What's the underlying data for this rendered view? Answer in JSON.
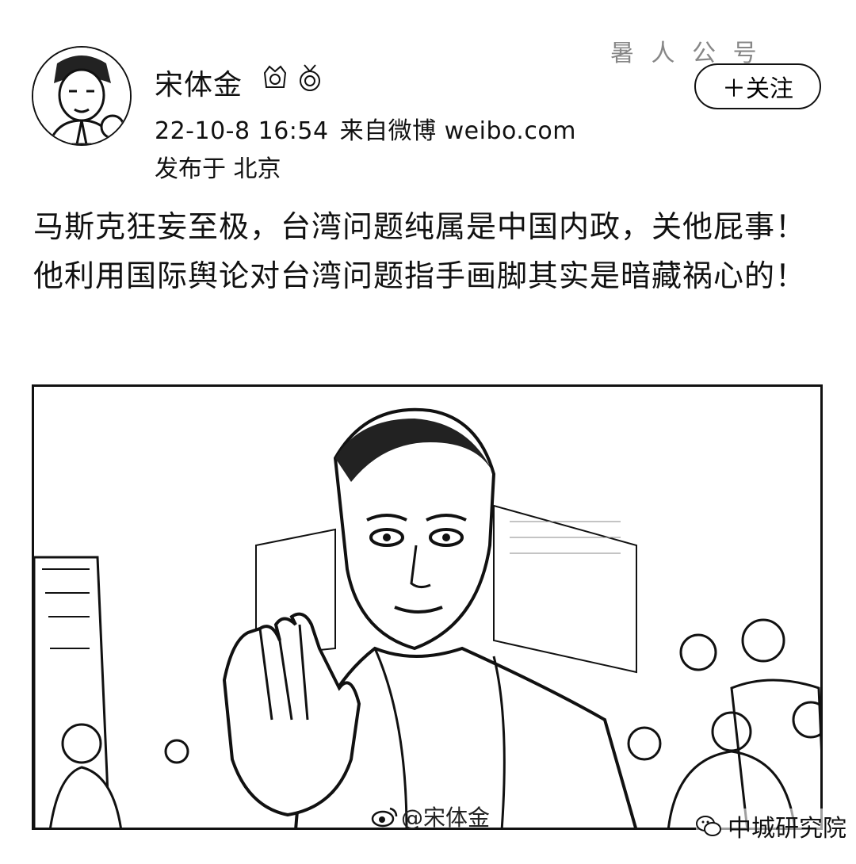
{
  "post": {
    "author": {
      "name": "宋体金",
      "badges": [
        "vip-badge-icon",
        "medal-badge-icon"
      ]
    },
    "meta": {
      "timestamp": "22-10-8 16:54",
      "source": "来自微博 weibo.com",
      "location": "发布于 北京"
    },
    "faded_overlay": "暑 人 公 号",
    "follow_label": "＋关注",
    "text": "马斯克狂妄至极，台湾问题纯属是中国内政，关他屁事！他利用国际舆论对台湾问题指手画脚其实是暗藏祸心的！",
    "image": {
      "watermark": "@宋体金"
    }
  },
  "corner_watermark": "中城研究院"
}
